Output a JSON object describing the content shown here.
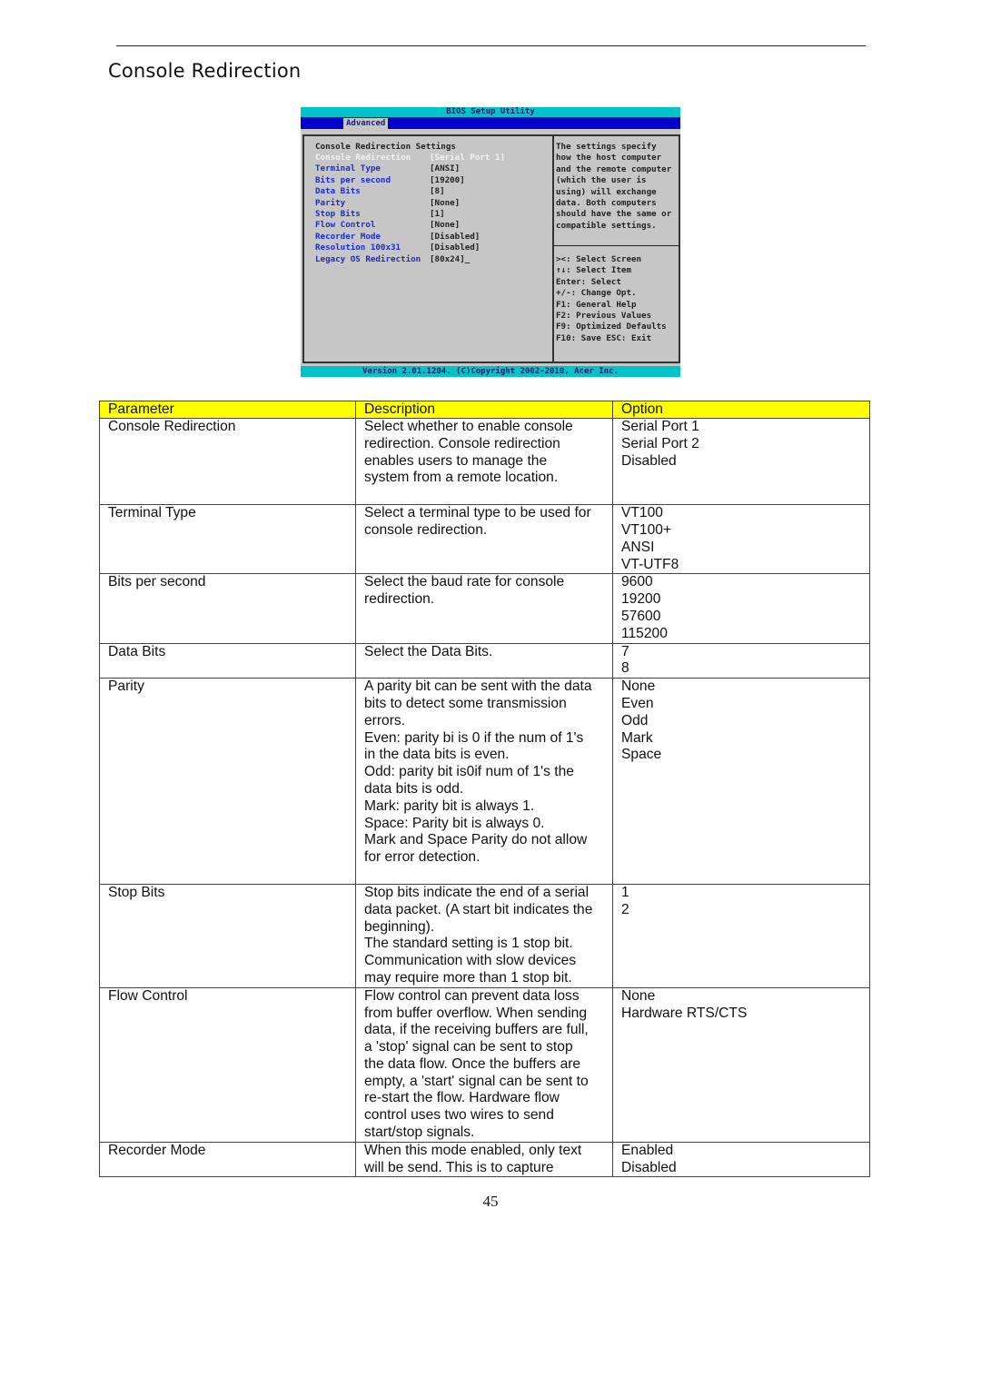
{
  "section_title": "Console Redirection",
  "bios": {
    "title": "BIOS Setup Utility",
    "active_tab": "Advanced",
    "heading": "Console Redirection Settings",
    "items": [
      {
        "label": "Console Redirection",
        "value": "[Serial Port 1]",
        "selected": true
      },
      {
        "label": "Terminal Type",
        "value": "[ANSI]",
        "selected": false
      },
      {
        "label": "Bits per second",
        "value": "[19200]",
        "selected": false
      },
      {
        "label": "Data Bits",
        "value": "[8]",
        "selected": false
      },
      {
        "label": "Parity",
        "value": "[None]",
        "selected": false
      },
      {
        "label": "Stop Bits",
        "value": "[1]",
        "selected": false
      },
      {
        "label": "Flow Control",
        "value": "[None]",
        "selected": false
      },
      {
        "label": "Recorder Mode",
        "value": "[Disabled]",
        "selected": false
      },
      {
        "label": "Resolution 100x31",
        "value": "[Disabled]",
        "selected": false
      },
      {
        "label": "Legacy OS Redirection",
        "value": "[80x24]_",
        "selected": false
      }
    ],
    "help_text": "The settings specify\nhow the host computer\nand the remote computer\n(which the user is\nusing) will exchange\ndata. Both computers\nshould have the same or\ncompatible settings.",
    "keys": [
      "><: Select Screen",
      "↑↓: Select Item",
      "Enter: Select",
      "+/-: Change Opt.",
      "F1: General Help",
      "F2: Previous Values",
      "F9: Optimized Defaults",
      "F10: Save  ESC: Exit"
    ],
    "footer": "Version 2.01.1204. (C)Copyright 2002-2010, Acer Inc.",
    "colors": {
      "title_bar": "#00c4c8",
      "menu_bar": "#0000c8",
      "panel": "#c6c6c6",
      "item_label": "#1c2cd0",
      "selected": "#f2f2f2"
    }
  },
  "table": {
    "header_color": "#ffff00",
    "headers": [
      "Parameter",
      "Description",
      "Option"
    ],
    "rows": [
      {
        "parameter": "Console Redirection",
        "description": [
          "Select whether to enable console",
          "redirection. Console redirection",
          "enables users to manage the",
          "system from a remote location."
        ],
        "options": [
          "Serial Port 1",
          "Serial Port 2",
          "Disabled"
        ],
        "pad": true
      },
      {
        "parameter": "Terminal Type",
        "description": [
          "Select a terminal type to be used for",
          "console redirection."
        ],
        "options": [
          "VT100",
          "VT100+",
          "ANSI",
          "VT-UTF8"
        ],
        "pad": true
      },
      {
        "parameter": "Bits per second",
        "description": [
          "Select the baud rate for console",
          "redirection."
        ],
        "options": [
          "9600",
          "19200",
          "57600",
          "115200"
        ],
        "pad": false
      },
      {
        "parameter": "Data Bits",
        "description": [
          "Select the Data Bits."
        ],
        "options": [
          "7",
          "8"
        ],
        "pad": false
      },
      {
        "parameter": "Parity",
        "description": [
          "A parity bit can be sent with the data",
          "bits to detect some transmission",
          "errors.",
          "Even: parity bi is 0 if the num of 1's",
          "in the data bits is even.",
          "Odd: parity bit is0if num of 1's the",
          "data bits is odd.",
          "Mark: parity bit is always 1.",
          "Space: Parity bit is always 0.",
          "Mark and Space Parity do not allow",
          "for error detection."
        ],
        "options": [
          "None",
          "Even",
          "Odd",
          "Mark",
          "Space"
        ],
        "pad": true
      },
      {
        "parameter": "Stop Bits",
        "description": [
          "Stop bits indicate the end of a serial",
          "data packet. (A start bit indicates the",
          "beginning).",
          "The standard setting is 1 stop bit.",
          "Communication with slow devices",
          "may require more than 1 stop bit."
        ],
        "options": [
          "1",
          "2"
        ],
        "pad": false
      },
      {
        "parameter": "Flow Control",
        "description": [
          "Flow control can prevent data loss",
          "from buffer overflow. When sending",
          "data, if the receiving buffers are full,",
          "a 'stop' signal can be sent to stop",
          "the data flow. Once the buffers are",
          "empty, a 'start' signal can be sent to",
          "re-start the flow. Hardware flow",
          "control uses two wires to send",
          "start/stop signals."
        ],
        "options": [
          "None",
          "Hardware RTS/CTS"
        ],
        "pad": false
      },
      {
        "parameter": "Recorder Mode",
        "description": [
          "When this mode enabled, only text",
          "will be send. This is to capture"
        ],
        "options": [
          "Enabled",
          "Disabled"
        ],
        "pad": false
      }
    ]
  },
  "page_number": "45"
}
